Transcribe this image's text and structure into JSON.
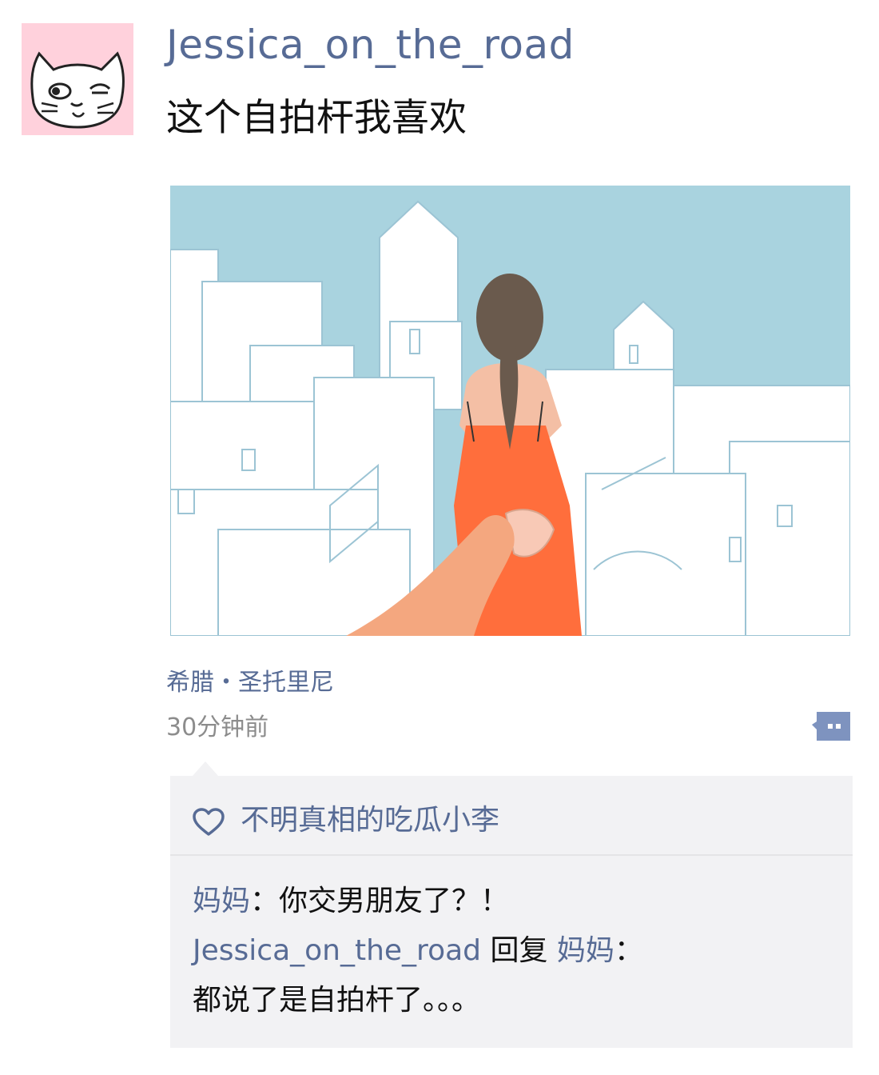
{
  "post": {
    "username": "Jessica_on_the_road",
    "text": "这个自拍杆我喜欢",
    "location": "希腊・圣托里尼",
    "time": "30分钟前",
    "image_icon": "illustration-couple-santorini"
  },
  "likes": {
    "icon": "heart-icon",
    "names": "不明真相的吃瓜小李"
  },
  "comments": [
    {
      "author": "妈妈",
      "separator": "：",
      "text": "你交男朋友了？！"
    },
    {
      "author": "Jessica_on_the_road",
      "reply_word": " 回复 ",
      "reply_to": "妈妈",
      "separator": "：",
      "text": "都说了是自拍杆了。。。"
    }
  ],
  "colors": {
    "link": "#576b95",
    "avatar_bg": "#ffd1dc",
    "sky": "#a9d3df",
    "dress": "#ff6e3c",
    "panel": "#f2f2f4"
  }
}
